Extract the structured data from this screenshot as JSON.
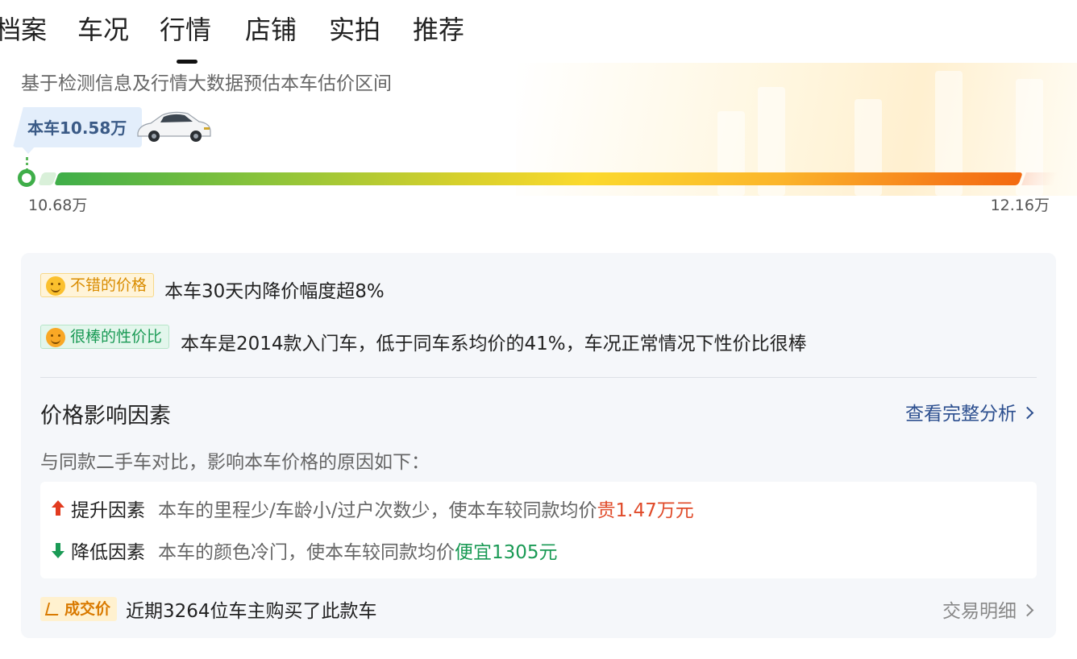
{
  "tabs": [
    {
      "label": "档案"
    },
    {
      "label": "车况"
    },
    {
      "label": "行情",
      "active": true
    },
    {
      "label": "店铺"
    },
    {
      "label": "实拍"
    },
    {
      "label": "推荐"
    }
  ],
  "estimate": {
    "subtitle": "基于检测信息及行情大数据预估本车估价区间",
    "current_price_label": "本车10.58万",
    "range_min": "10.68万",
    "range_max": "12.16万"
  },
  "tags": [
    {
      "label": "不错的价格",
      "text": "本车30天内降价幅度超8%"
    },
    {
      "label": "很棒的性价比",
      "text": "本车是2014款入门车，低于同车系均价的41%，车况正常情况下性价比很棒"
    }
  ],
  "factors_section": {
    "title": "价格影响因素",
    "link": "查看完整分析",
    "note": "与同款二手车对比，影响本车价格的原因如下：",
    "up": {
      "label": "提升因素",
      "desc": "本车的里程少/车龄小/过户次数少，使本车较同款均价",
      "value": "贵1.47万元"
    },
    "down": {
      "label": "降低因素",
      "desc": "本车的颜色冷门，使本车较同款均价",
      "value": "便宜1305元"
    }
  },
  "deal": {
    "badge": "成交价",
    "text": "近期3264位车主购买了此款车",
    "link": "交易明细"
  },
  "colors": {
    "accent_blue": "#2c4f8f",
    "up_red": "#e04b2a",
    "down_green": "#1a9a55",
    "badge_orange": "#d98c00"
  }
}
